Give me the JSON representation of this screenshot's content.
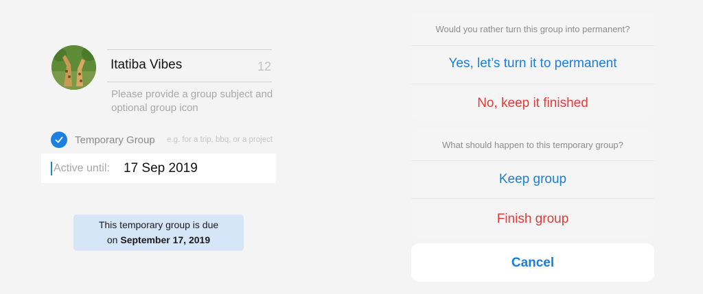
{
  "group_setup": {
    "avatar_icon": "giraffe-photo",
    "name": "Itatiba Vibes",
    "char_count": "12",
    "hint": "Please provide a group subject and optional group icon",
    "temporary": {
      "checked": true,
      "label": "Temporary Group",
      "placeholder": "e.g. for a trip, bbq, or a project"
    },
    "active_until": {
      "label": "Active until:",
      "value": "17 Sep 2019"
    },
    "due_notice": {
      "line1": "This temporary group is due",
      "line2_prefix": "on ",
      "line2_date": "September 17, 2019"
    }
  },
  "sheet_permanent": {
    "title": "Would you rather turn this group into permanent?",
    "yes": "Yes, let’s turn it to permanent",
    "no": "No, keep it finished"
  },
  "sheet_temporary": {
    "title": "What should happen to this temporary group?",
    "keep": "Keep group",
    "finish": "Finish group"
  },
  "cancel_label": "Cancel",
  "colors": {
    "accent_blue": "#1a7ee0",
    "destructive_red": "#e53a35",
    "notice_bg": "#d4e6f7"
  }
}
